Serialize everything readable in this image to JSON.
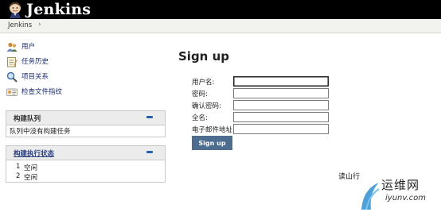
{
  "header": {
    "brand": "Jenkins",
    "logo_icon": "jenkins-butler-icon"
  },
  "breadcrumb": {
    "root": "Jenkins",
    "separator": "›"
  },
  "sidebar": {
    "tasks": [
      {
        "label": "用户",
        "icon": "users-icon"
      },
      {
        "label": "任务历史",
        "icon": "notepad-icon"
      },
      {
        "label": "项目关系",
        "icon": "search-icon"
      },
      {
        "label": "检查文件指纹",
        "icon": "fingerprint-icon"
      }
    ],
    "build_queue": {
      "title": "构建队列",
      "empty_message": "队列中没有构建任务"
    },
    "executors": {
      "title": "构建执行状态",
      "rows": [
        {
          "index": "1",
          "status": "空闲"
        },
        {
          "index": "2",
          "status": "空闲"
        }
      ]
    }
  },
  "main": {
    "title": "Sign up",
    "form": {
      "username_label": "用户名:",
      "password_label": "密码:",
      "confirm_label": "确认密码:",
      "fullname_label": "全名:",
      "email_label": "电子邮件地址:",
      "submit_label": "Sign up"
    },
    "note": "读山行"
  },
  "watermark": {
    "cn": "运维网",
    "url": "iyunv.com"
  },
  "colors": {
    "header_bg": "#000000",
    "button_bg": "#4d6d90",
    "link": "#2b3e7e",
    "collapse": "#2a5ea8"
  }
}
